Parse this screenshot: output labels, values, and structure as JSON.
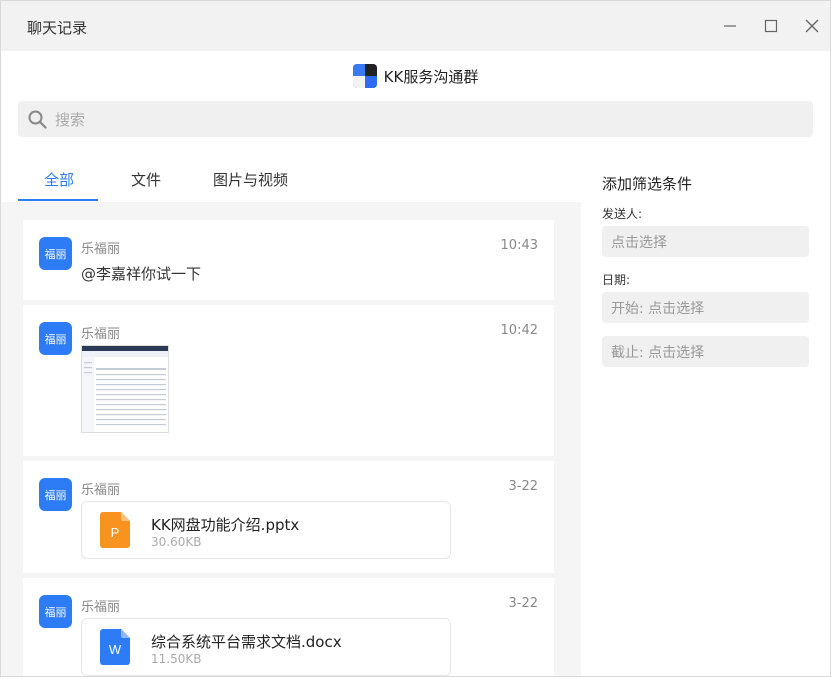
{
  "window": {
    "title": "聊天记录"
  },
  "group": {
    "name": "KK服务沟通群"
  },
  "search": {
    "placeholder": "搜索"
  },
  "tabs": [
    {
      "label": "全部",
      "active": true
    },
    {
      "label": "文件",
      "active": false
    },
    {
      "label": "图片与视频",
      "active": false
    }
  ],
  "messages": [
    {
      "type": "text",
      "avatar_text": "福丽",
      "sender": "乐福丽",
      "time": "10:43",
      "text": "@李嘉祥你试一下"
    },
    {
      "type": "image",
      "avatar_text": "福丽",
      "sender": "乐福丽",
      "time": "10:42"
    },
    {
      "type": "file",
      "avatar_text": "福丽",
      "sender": "乐福丽",
      "time": "3-22",
      "file_name": "KK网盘功能介绍.pptx",
      "file_size": "30.60KB",
      "file_icon_letter": "P",
      "file_icon_color": "#f7931e"
    },
    {
      "type": "file",
      "avatar_text": "福丽",
      "sender": "乐福丽",
      "time": "3-22",
      "file_name": "综合系统平台需求文档.docx",
      "file_size": "11.50KB",
      "file_icon_letter": "W",
      "file_icon_color": "#2d7cf6"
    }
  ],
  "filter": {
    "title": "添加筛选条件",
    "sender_label": "发送人:",
    "sender_placeholder": "点击选择",
    "date_label": "日期:",
    "start_placeholder": "开始: 点击选择",
    "end_placeholder": "截止: 点击选择"
  },
  "colors": {
    "accent": "#2d7cf6",
    "avatar_bg": "#2d7cf6"
  }
}
